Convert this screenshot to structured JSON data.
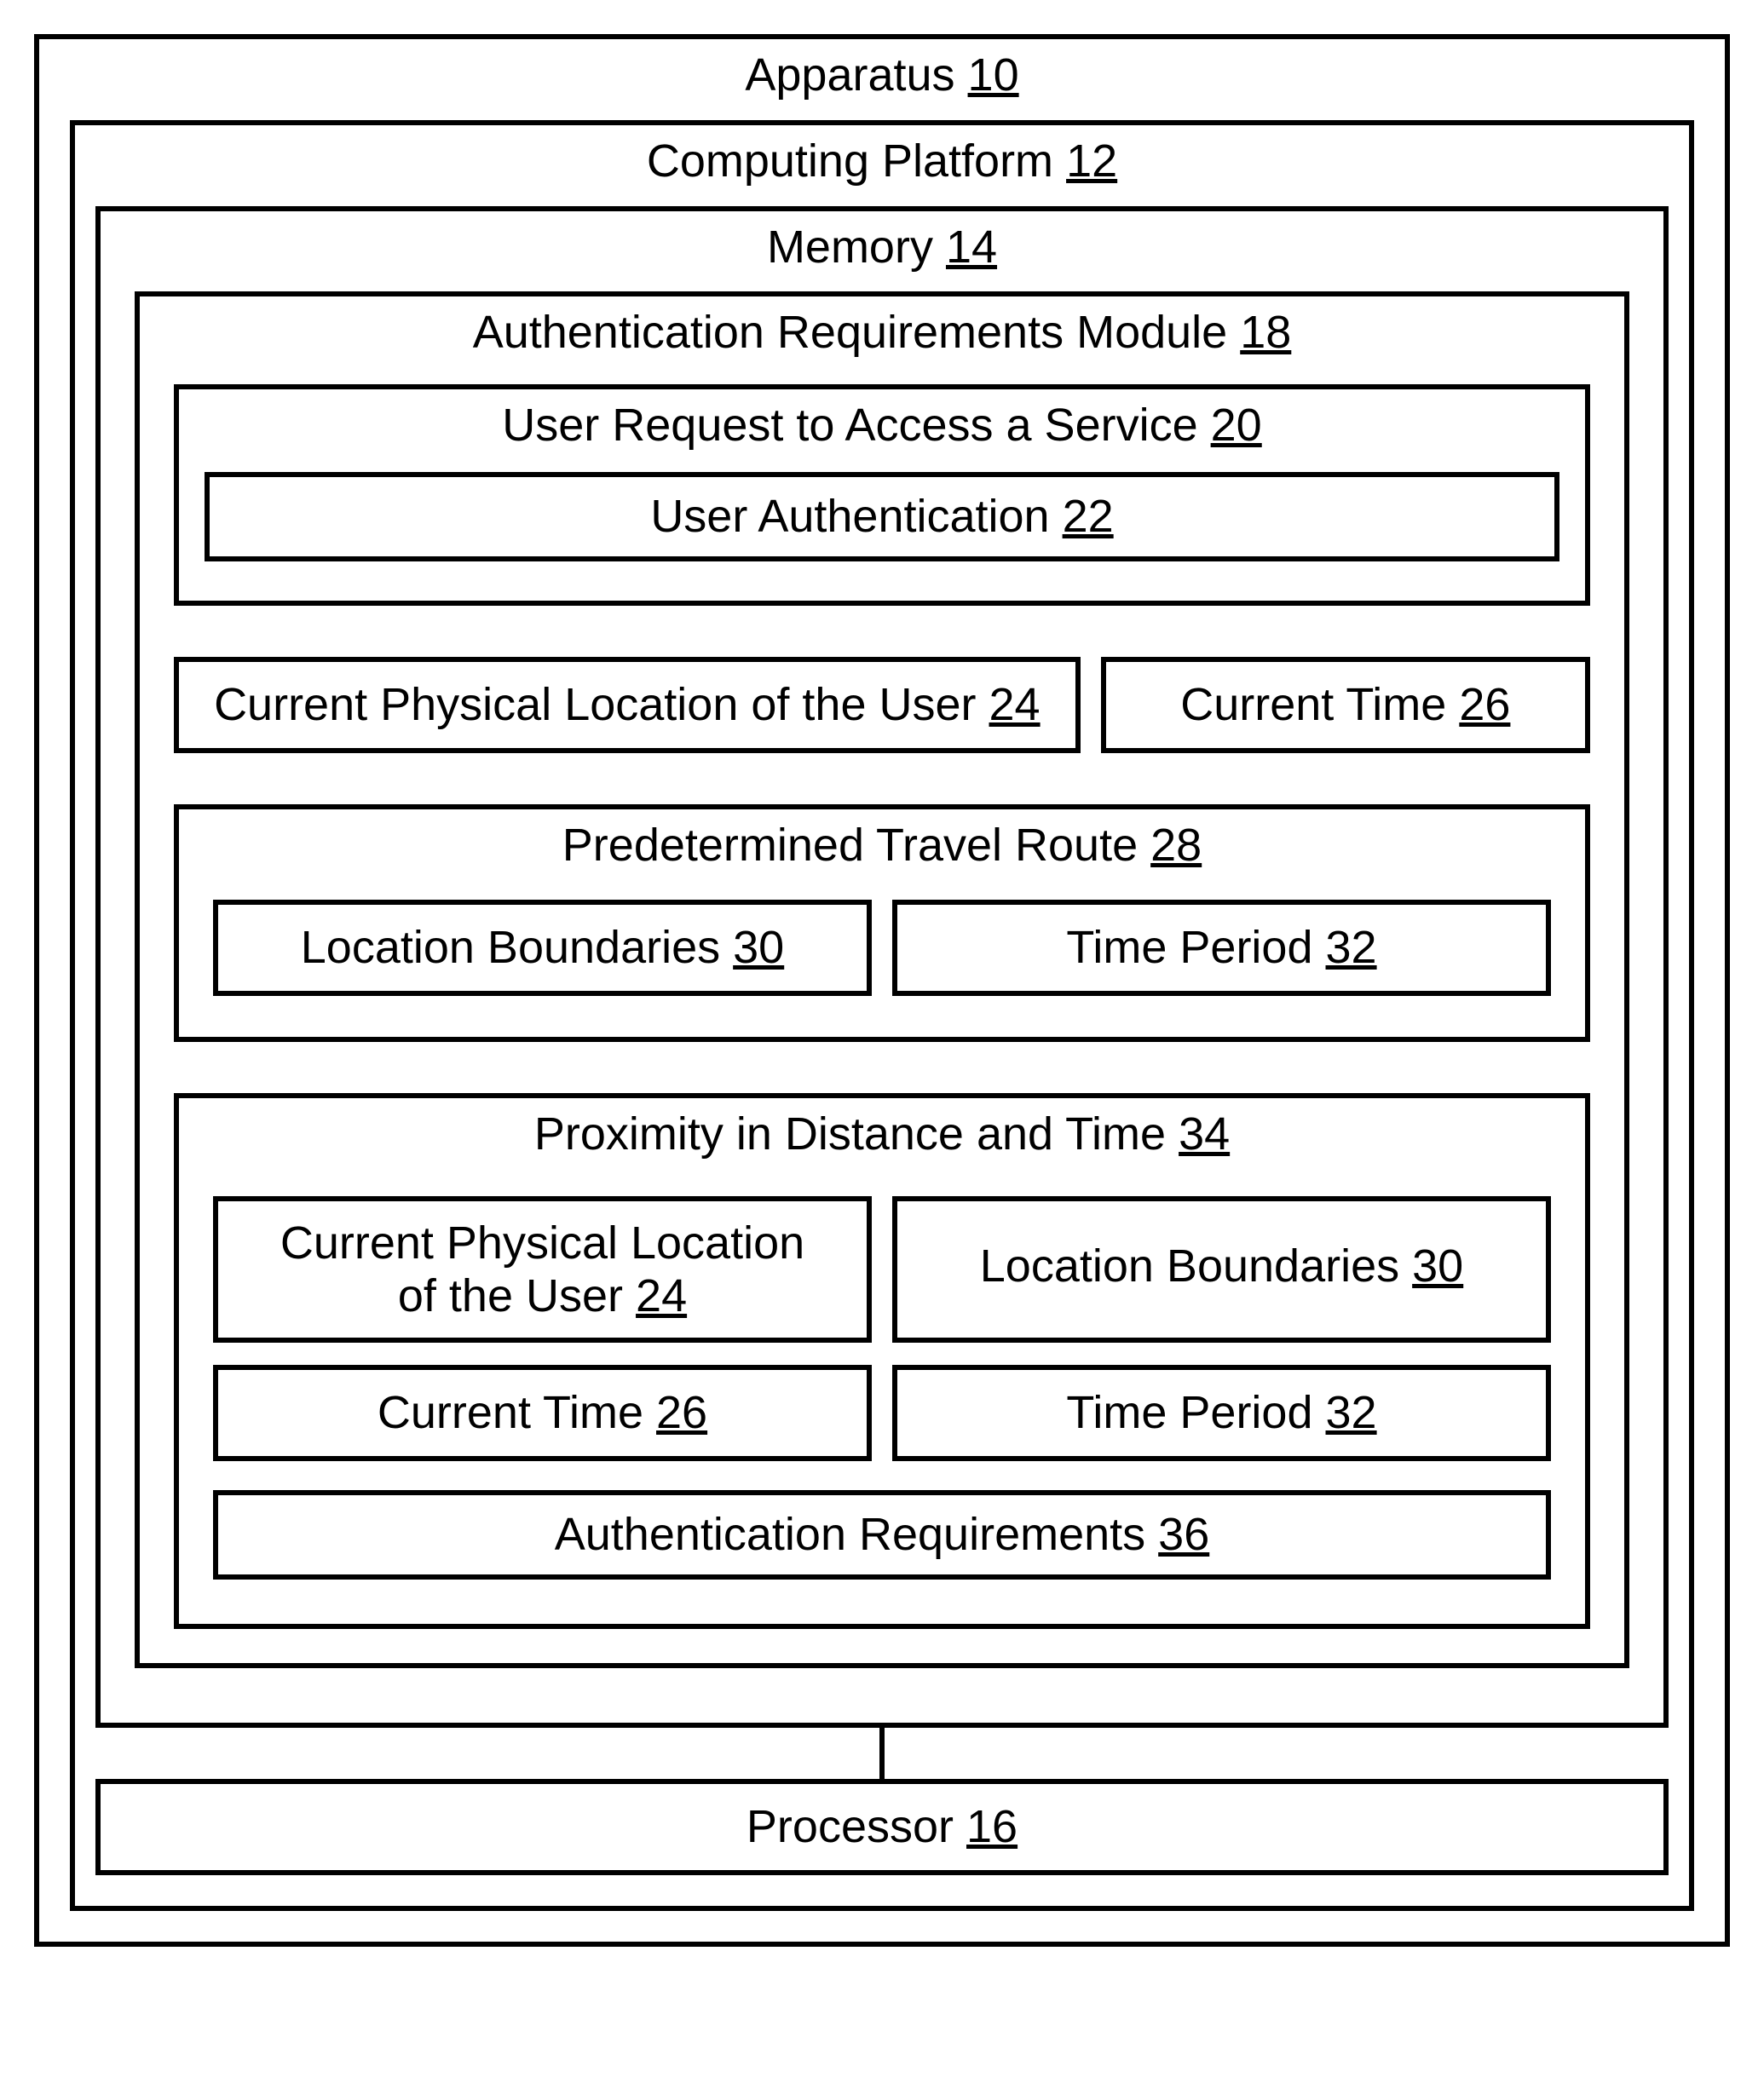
{
  "apparatus": {
    "label": "Apparatus",
    "num": "10"
  },
  "computing": {
    "label": "Computing Platform",
    "num": "12"
  },
  "memory": {
    "label": "Memory",
    "num": "14"
  },
  "processor": {
    "label": "Processor",
    "num": "16"
  },
  "auth_mod": {
    "label": "Authentication Requirements Module",
    "num": "18"
  },
  "user_request": {
    "label": "User Request to Access a Service",
    "num": "20"
  },
  "user_auth": {
    "label": "User Authentication",
    "num": "22"
  },
  "cur_loc": {
    "label": "Current Physical Location of the User",
    "num": "24"
  },
  "cur_time": {
    "label": "Current Time",
    "num": "26"
  },
  "travel_route": {
    "label": "Predetermined Travel Route",
    "num": "28"
  },
  "loc_bounds": {
    "label": "Location Boundaries",
    "num": "30"
  },
  "time_period": {
    "label": "Time Period",
    "num": "32"
  },
  "proximity": {
    "label": "Proximity in Distance and Time",
    "num": "34"
  },
  "cur_loc_2a": "Current Physical Location",
  "cur_loc_2b": "of the User",
  "cur_loc_2num": "24",
  "loc_bounds_2": {
    "label": "Location Boundaries",
    "num": "30"
  },
  "cur_time_2": {
    "label": "Current Time",
    "num": "26"
  },
  "time_period_2": {
    "label": "Time Period",
    "num": "32"
  },
  "auth_reqs": {
    "label": "Authentication Requirements",
    "num": "36"
  }
}
